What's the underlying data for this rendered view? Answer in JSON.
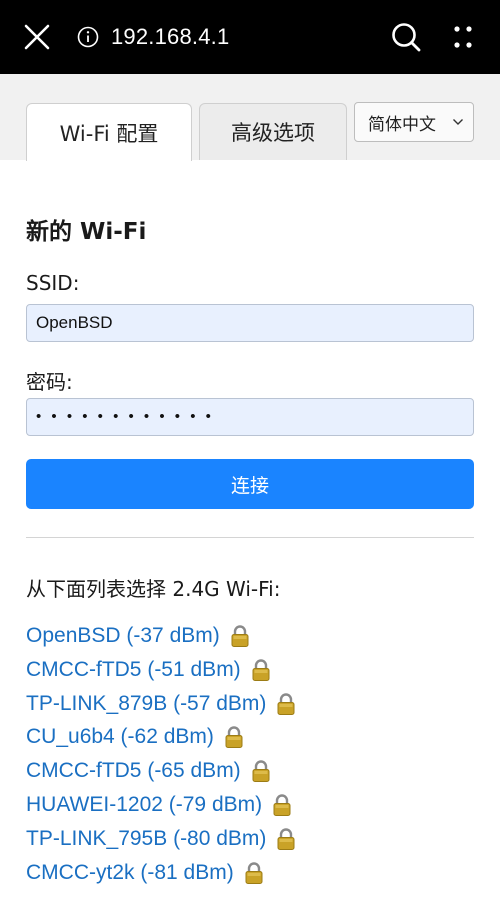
{
  "browser": {
    "url": "192.168.4.1"
  },
  "tabs": [
    {
      "label": "Wi-Fi 配置",
      "active": true
    },
    {
      "label": "高级选项",
      "active": false
    }
  ],
  "language": {
    "selected": "简体中文"
  },
  "form": {
    "title": "新的 Wi-Fi",
    "ssid_label": "SSID:",
    "ssid_value": "OpenBSD",
    "password_label": "密码:",
    "password_value": "• • • • • • • • • • • •",
    "connect_label": "连接"
  },
  "list": {
    "heading": "从下面列表选择 2.4G Wi-Fi:",
    "networks": [
      {
        "text": "OpenBSD (-37 dBm)",
        "locked": true
      },
      {
        "text": "CMCC-fTD5 (-51 dBm)",
        "locked": true
      },
      {
        "text": "TP-LINK_879B (-57 dBm)",
        "locked": true
      },
      {
        "text": "CU_u6b4 (-62 dBm)",
        "locked": true
      },
      {
        "text": "CMCC-fTD5 (-65 dBm)",
        "locked": true
      },
      {
        "text": "HUAWEI-1202 (-79 dBm)",
        "locked": true
      },
      {
        "text": "TP-LINK_795B (-80 dBm)",
        "locked": true
      },
      {
        "text": "CMCC-yt2k (-81 dBm)",
        "locked": true
      }
    ]
  },
  "colors": {
    "link": "#1a6fc2",
    "button": "#1a84ff",
    "input_bg": "#e8f0fe",
    "lock": "#c9a227"
  }
}
